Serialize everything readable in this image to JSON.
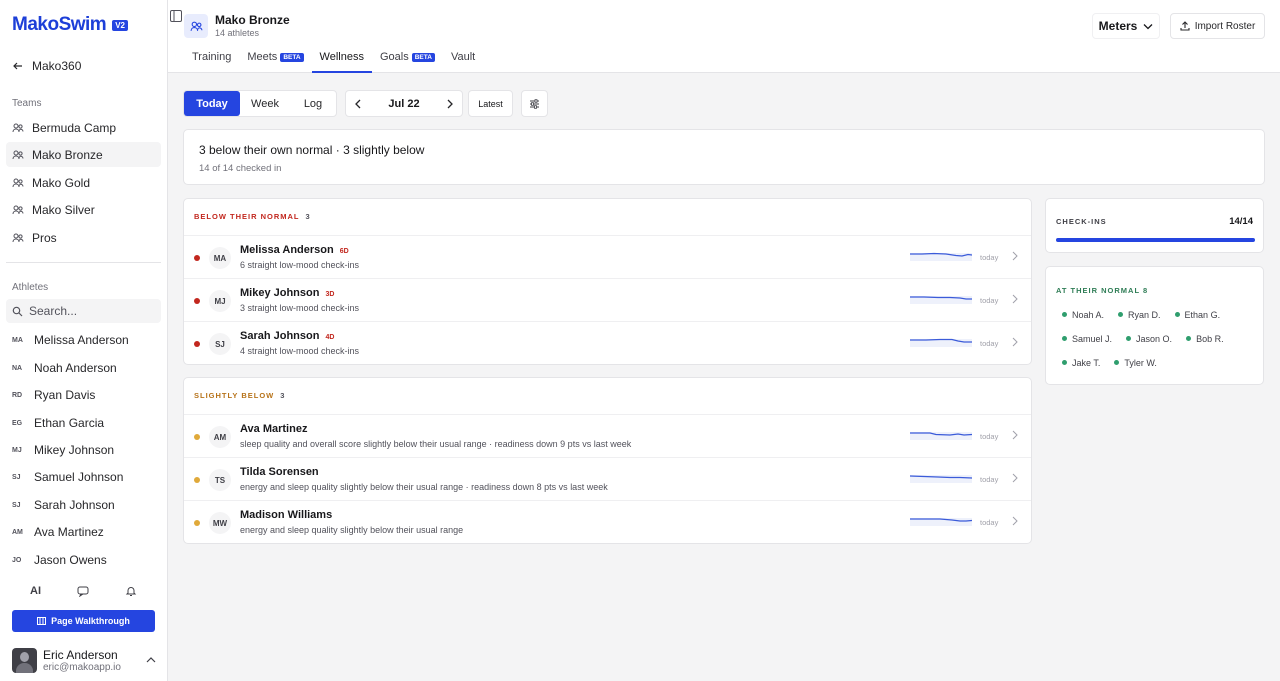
{
  "app": {
    "logo": "MakoSwim",
    "version": "V2"
  },
  "sidebar": {
    "back_label": "Mako360",
    "teams_label": "Teams",
    "teams": [
      {
        "label": "Bermuda Camp",
        "active": false
      },
      {
        "label": "Mako Bronze",
        "active": true
      },
      {
        "label": "Mako Gold",
        "active": false
      },
      {
        "label": "Mako Silver",
        "active": false
      },
      {
        "label": "Pros",
        "active": false
      }
    ],
    "athletes_label": "Athletes",
    "search_placeholder": "Search...",
    "athletes": [
      {
        "initials": "MA",
        "name": "Melissa Anderson"
      },
      {
        "initials": "NA",
        "name": "Noah Anderson"
      },
      {
        "initials": "RD",
        "name": "Ryan Davis"
      },
      {
        "initials": "EG",
        "name": "Ethan Garcia"
      },
      {
        "initials": "MJ",
        "name": "Mikey Johnson"
      },
      {
        "initials": "SJ",
        "name": "Samuel Johnson"
      },
      {
        "initials": "SJ",
        "name": "Sarah Johnson"
      },
      {
        "initials": "AM",
        "name": "Ava Martinez"
      },
      {
        "initials": "JO",
        "name": "Jason Owens"
      }
    ],
    "ai_label": "AI",
    "walkthrough_label": "Page Walkthrough",
    "user": {
      "name": "Eric Anderson",
      "email": "eric@makoapp.io"
    }
  },
  "header": {
    "team_name": "Mako Bronze",
    "team_sub": "14 athletes",
    "tabs": [
      {
        "label": "Training",
        "beta": false,
        "active": false
      },
      {
        "label": "Meets",
        "beta": true,
        "active": false
      },
      {
        "label": "Wellness",
        "beta": false,
        "active": true
      },
      {
        "label": "Goals",
        "beta": true,
        "active": false
      },
      {
        "label": "Vault",
        "beta": false,
        "active": false
      }
    ],
    "beta_label": "BETA",
    "units_label": "Meters",
    "import_label": "Import Roster"
  },
  "toolbar": {
    "segments": [
      "Today",
      "Week",
      "Log"
    ],
    "active_segment": "Today",
    "date": "Jul 22",
    "latest_label": "Latest"
  },
  "summary": {
    "title": "3 below their own normal · 3 slightly below",
    "sub": "14 of 14 checked in"
  },
  "below_section": {
    "title": "BELOW THEIR NORMAL",
    "count": "3",
    "color": "#c2271e",
    "rows": [
      {
        "initials": "MA",
        "name": "Melissa Anderson",
        "streak": "6D",
        "desc": "6 straight low-mood check-ins",
        "when": "today"
      },
      {
        "initials": "MJ",
        "name": "Mikey Johnson",
        "streak": "3D",
        "desc": "3 straight low-mood check-ins",
        "when": "today"
      },
      {
        "initials": "SJ",
        "name": "Sarah Johnson",
        "streak": "4D",
        "desc": "4 straight low-mood check-ins",
        "when": "today"
      }
    ]
  },
  "slightly_section": {
    "title": "SLIGHTLY BELOW",
    "count": "3",
    "color": "#e0a93a",
    "rows": [
      {
        "initials": "AM",
        "name": "Ava Martinez",
        "streak": "",
        "desc": "sleep quality and overall score slightly below their usual range · readiness down 9 pts vs last week",
        "when": "today"
      },
      {
        "initials": "TS",
        "name": "Tilda Sorensen",
        "streak": "",
        "desc": "energy and sleep quality slightly below their usual range · readiness down 8 pts vs last week",
        "when": "today"
      },
      {
        "initials": "MW",
        "name": "Madison Williams",
        "streak": "",
        "desc": "energy and sleep quality slightly below their usual range",
        "when": "today"
      }
    ]
  },
  "checkins": {
    "label": "CHECK-INS",
    "value": "14/14",
    "progress": 1.0
  },
  "at_normal": {
    "title": "AT THEIR NORMAL 8",
    "names": [
      "Noah A.",
      "Ryan D.",
      "Ethan G.",
      "Samuel J.",
      "Jason O.",
      "Bob R.",
      "Jake T.",
      "Tyler W."
    ]
  },
  "colors": {
    "accent": "#2545e0",
    "danger": "#c2271e",
    "warning": "#e0a93a",
    "success": "#2f9e6e"
  }
}
